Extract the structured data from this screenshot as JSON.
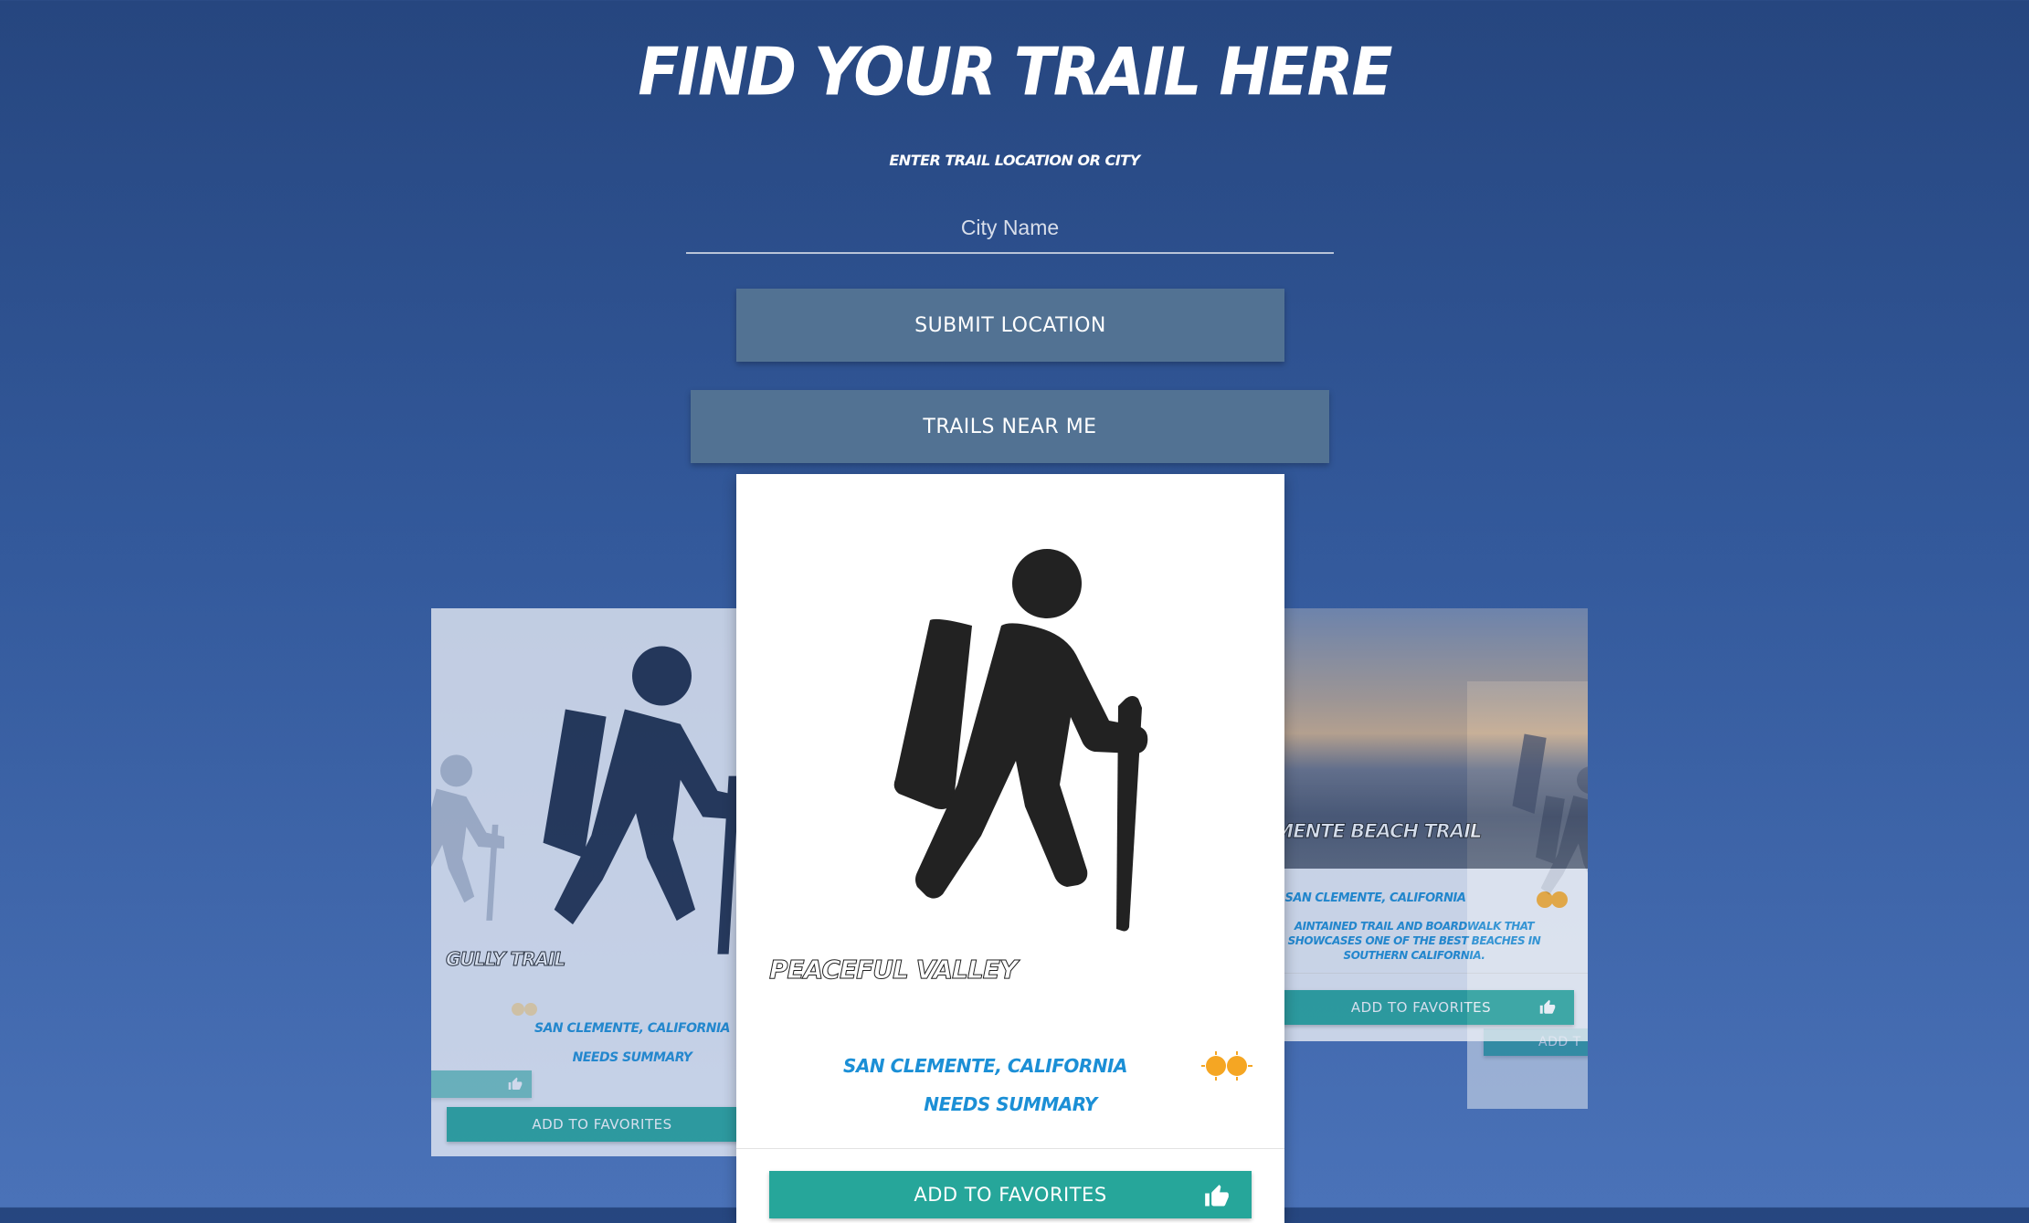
{
  "header": {
    "title": "FIND YOUR TRAIL HERE",
    "subtitle": "ENTER TRAIL LOCATION OR CITY"
  },
  "search": {
    "placeholder": "City Name",
    "value": ""
  },
  "buttons": {
    "submit_label": "SUBMIT LOCATION",
    "near_label": "TRAILS NEAR ME"
  },
  "carousel": {
    "left_card": {
      "name": "GULLY TRAIL",
      "location": "SAN CLEMENTE, CALIFORNIA",
      "summary": "NEEDS SUMMARY",
      "favorite_label": "ADD TO FAVORITES"
    },
    "center_card": {
      "name": "PEACEFUL VALLEY",
      "location": "SAN CLEMENTE, CALIFORNIA",
      "summary": "NEEDS SUMMARY",
      "favorite_label": "ADD TO FAVORITES"
    },
    "right_card": {
      "name": "EMENTE BEACH TRAIL",
      "location": "SAN CLEMENTE, CALIFORNIA",
      "summary": "AINTAINED TRAIL AND BOARDWALK THAT SHOWCASES ONE OF THE BEST BEACHES IN SOUTHERN CALIFORNIA.",
      "favorite_label": "ADD TO FAVORITES"
    },
    "far_card": {
      "favorite_label": "ADD T"
    }
  },
  "colors": {
    "background_top": "#26467f",
    "background_bottom": "#4a72b8",
    "primary_button": "#527293",
    "favorite_button": "#26a69a",
    "location_text": "#1b8fd6",
    "rating_icon": "#f5a623"
  },
  "icons": [
    "hiker-icon",
    "thumbs-up-icon",
    "sun-rating-icon"
  ]
}
